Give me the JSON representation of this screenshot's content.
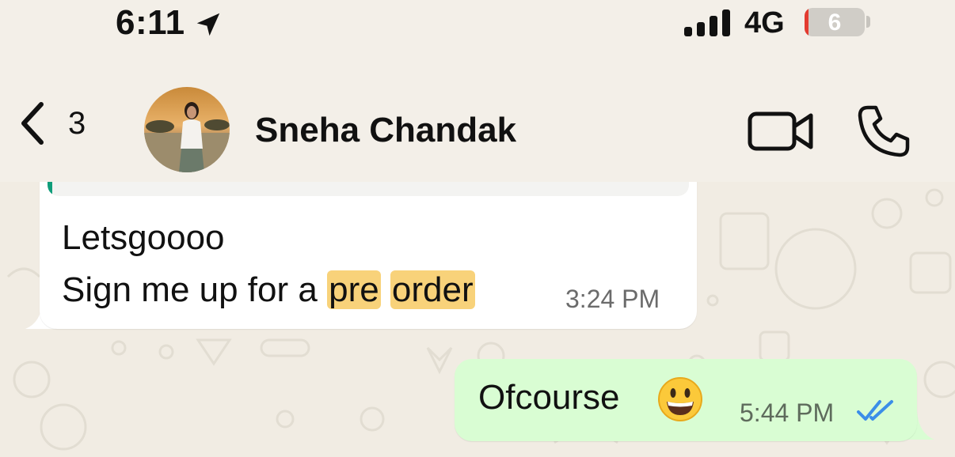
{
  "status_bar": {
    "time": "6:11",
    "location_icon": "location-arrow-icon",
    "network": "4G",
    "signal_icon": "cellular-signal-icon",
    "battery": {
      "level": "6",
      "level_fraction": 0.06,
      "color": "#e33b30"
    }
  },
  "header": {
    "back_icon": "chevron-left-icon",
    "unread_count": "3",
    "contact_name": "Sneha Chandak",
    "video_call_icon": "video-camera-icon",
    "voice_call_icon": "phone-icon"
  },
  "messages": [
    {
      "direction": "incoming",
      "lines": [
        "Letsgoooo",
        "Sign me up for a"
      ],
      "highlighted_words": [
        "pre",
        "order"
      ],
      "time": "3:24 PM",
      "has_quoted_reply": true
    },
    {
      "direction": "outgoing",
      "text": "Ofcourse",
      "emoji": "grinning-face-emoji",
      "time": "5:44 PM",
      "status_icon": "double-check-read-icon"
    }
  ],
  "colors": {
    "background": "#f3efe8",
    "incoming_bubble": "#ffffff",
    "outgoing_bubble": "#d9fdd3",
    "highlight": "#f8d27a",
    "read_receipt": "#3b8ee8"
  }
}
